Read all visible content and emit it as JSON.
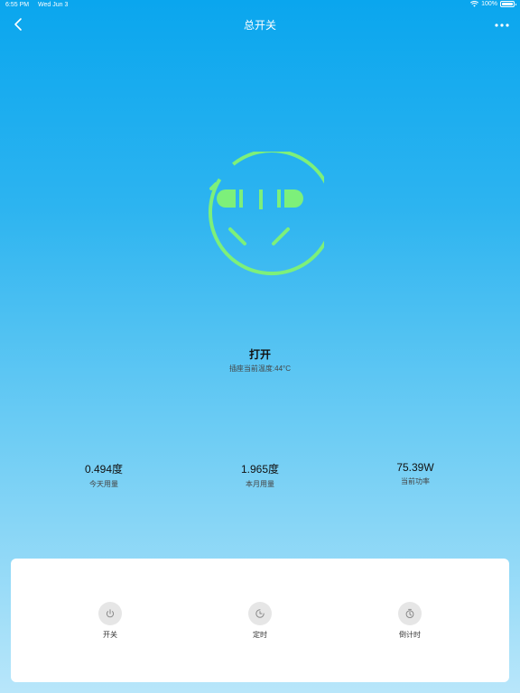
{
  "status_bar": {
    "time": "6:55 PM",
    "date": "Wed Jun 3",
    "battery": "100%"
  },
  "nav": {
    "title": "总开关"
  },
  "socket": {
    "state": "打开",
    "temperature": "插座当前温度:44°C",
    "accent_color": "#7df07a"
  },
  "stats": [
    {
      "value": "0.494度",
      "label": "今天用量"
    },
    {
      "value": "1.965度",
      "label": "本月用量"
    },
    {
      "value": "75.39W",
      "label": "当前功率"
    }
  ],
  "controls": [
    {
      "label": "开关",
      "icon": "power-icon"
    },
    {
      "label": "定时",
      "icon": "clock-icon"
    },
    {
      "label": "倒计时",
      "icon": "timer-icon"
    }
  ]
}
